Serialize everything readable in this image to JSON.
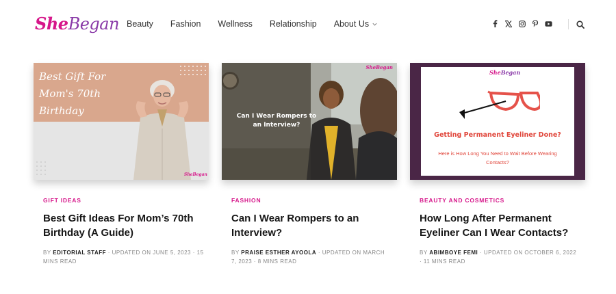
{
  "logo": {
    "part1": "She",
    "part2": "Began"
  },
  "nav": {
    "items": [
      {
        "label": "Beauty"
      },
      {
        "label": "Fashion"
      },
      {
        "label": "Wellness"
      },
      {
        "label": "Relationship"
      },
      {
        "label": "About Us"
      }
    ]
  },
  "social": [
    "facebook-icon",
    "x-twitter-icon",
    "instagram-icon",
    "pinterest-icon",
    "youtube-icon"
  ],
  "colors": {
    "brand_pink": "#d6168a",
    "brand_purple": "#8a3aa8",
    "accent_red": "#e0453a"
  },
  "cards": [
    {
      "category": "GIFT IDEAS",
      "title": "Best Gift Ideas For Mom’s 70th Birthday (A Guide)",
      "meta_by": "BY",
      "author": "EDITORIAL STAFF",
      "meta_rest": "· UPDATED ON JUNE 5, 2023 · 15 MINS READ",
      "image_text": "Best Gift For\nMom's 70th\nBirthday",
      "image_brand": "SheBegan"
    },
    {
      "category": "FASHION",
      "title": "Can I Wear Rompers to an Interview?",
      "meta_by": "BY",
      "author": "PRAISE ESTHER AYOOLA",
      "meta_rest": "· UPDATED ON MARCH 7, 2023 · 8 MINS READ",
      "image_text": "Can I Wear Rompers to an Interview?",
      "image_brand": "SheBegan"
    },
    {
      "category": "BEAUTY AND COSMETICS",
      "title": "How Long After Permanent Eyeliner Can I Wear Contacts?",
      "meta_by": "BY",
      "author": "ABIMBOYE FEMI",
      "meta_rest": "· UPDATED ON OCTOBER 6, 2022 · 11 MINS READ",
      "image_text": "Getting Permanent Eyeliner Done?",
      "image_subtext": "Here is How Long You Need to Wait Before Wearing Contacts?",
      "image_brand": "SheBegan"
    }
  ]
}
